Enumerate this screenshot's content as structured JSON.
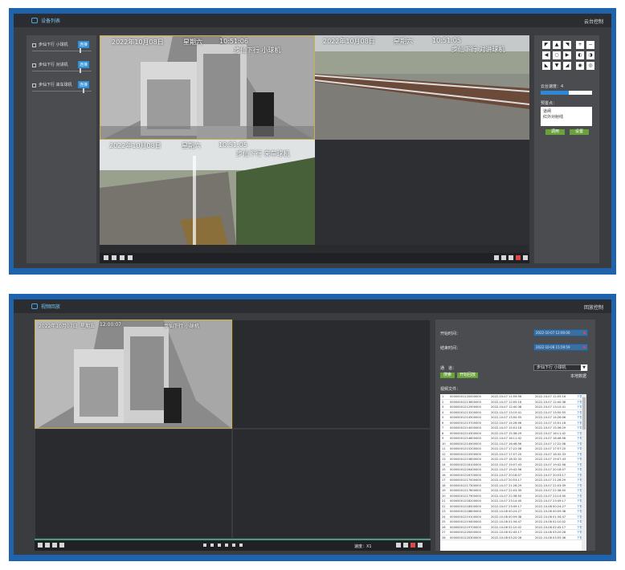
{
  "panel1": {
    "title": "设备列表",
    "right_label": "云台控制",
    "cameras": [
      {
        "name": "步仙下行 小球机",
        "state": "连接"
      },
      {
        "name": "步仙下行 对讲机",
        "state": "连接"
      },
      {
        "name": "步仙下行 来车球机",
        "state": "连接"
      }
    ],
    "videos": [
      {
        "date": "2022年10月08日",
        "weekday": "星期六",
        "time": "10:51:06",
        "camera": "步仙下行 小球机"
      },
      {
        "date": "2022年10月08日",
        "weekday": "星期六",
        "time": "10:51:05",
        "camera": "步仙下行 对讲球机"
      },
      {
        "date": "2022年10月08日",
        "weekday": "星期六",
        "time": "10:51:05",
        "camera": "步仙下行 来车球机"
      }
    ],
    "ptz": {
      "speed_label": "云台速度：",
      "speed_value": "4",
      "speed_fraction": 0.55,
      "preset_label": "预置点：",
      "presets": [
        "道闸",
        "红外对射线"
      ],
      "call_button": "调用",
      "set_button": "设置"
    }
  },
  "panel2": {
    "title": "视频回放",
    "right_label": "回放控制",
    "video": {
      "date": "2022年10月07日",
      "weekday": "星期五",
      "time": "12:00:07",
      "camera": "步仙下行 小球机"
    },
    "speed_label": "速度：X1",
    "form": {
      "start_label": "开始时间：",
      "start_value": "2022-10-07 12:00:00",
      "end_label": "结束时间：",
      "end_value": "2022-10-08 15:59:59",
      "channel_label": "通　道：",
      "channel_value": "步仙下行 小球机",
      "search_button": "搜索",
      "play_button": "开始回放",
      "local_label": "本地数据",
      "files_label": "视频文件："
    },
    "files": [
      {
        "no": "1",
        "file": "00000001120000000",
        "start": "2022-10-07 11:59:56",
        "end": "2022-10-07 12:05:16",
        "action": "下载"
      },
      {
        "no": "2",
        "file": "00000001213600000",
        "start": "2022-10-07 12:05:16",
        "end": "2022-10-07 12:40:38",
        "action": "下载"
      },
      {
        "no": "3",
        "file": "00000001212900000",
        "start": "2022-10-07 12:40:38",
        "end": "2022-10-07 13:15:41",
        "action": "下载"
      },
      {
        "no": "4",
        "file": "00000001213200000",
        "start": "2022-10-07 13:15:41",
        "end": "2022-10-07 13:50:55",
        "action": "下载"
      },
      {
        "no": "5",
        "file": "00000001214500000",
        "start": "2022-10-07 13:50:55",
        "end": "2022-10-07 14:26:06",
        "action": "下载"
      },
      {
        "no": "6",
        "file": "00000001213700000",
        "start": "2022-10-07 14:26:06",
        "end": "2022-10-07 15:01:18",
        "action": "下载"
      },
      {
        "no": "7",
        "file": "00000001214000000",
        "start": "2022-10-07 15:01:18",
        "end": "2022-10-07 15:36:29",
        "action": "下载"
      },
      {
        "no": "8",
        "file": "00000001214300000",
        "start": "2022-10-07 15:36:29",
        "end": "2022-10-07 16:11:42",
        "action": "下载"
      },
      {
        "no": "9",
        "file": "00000001214600000",
        "start": "2022-10-07 16:11:42",
        "end": "2022-10-07 16:46:56",
        "action": "下载"
      },
      {
        "no": "10",
        "file": "00000001214900000",
        "start": "2022-10-07 16:46:56",
        "end": "2022-10-07 17:22:08",
        "action": "下载"
      },
      {
        "no": "11",
        "file": "00000001215200000",
        "start": "2022-10-07 17:22:08",
        "end": "2022-10-07 17:57:20",
        "action": "下载"
      },
      {
        "no": "12",
        "file": "00000001215500000",
        "start": "2022-10-07 17:57:20",
        "end": "2022-10-07 18:32:33",
        "action": "下载"
      },
      {
        "no": "13",
        "file": "00000001215800000",
        "start": "2022-10-07 18:32:33",
        "end": "2022-10-07 19:07:43",
        "action": "下载"
      },
      {
        "no": "14",
        "file": "00000001216100000",
        "start": "2022-10-07 19:07:43",
        "end": "2022-10-07 19:42:56",
        "action": "下载"
      },
      {
        "no": "15",
        "file": "00000001216400000",
        "start": "2022-10-07 19:42:56",
        "end": "2022-10-07 20:18:07",
        "action": "下载"
      },
      {
        "no": "16",
        "file": "00000001216700000",
        "start": "2022-10-07 20:18:07",
        "end": "2022-10-07 20:53:17",
        "action": "下载"
      },
      {
        "no": "17",
        "file": "00000001217000000",
        "start": "2022-10-07 20:53:17",
        "end": "2022-10-07 21:28:29",
        "action": "下载"
      },
      {
        "no": "18",
        "file": "00000001217300000",
        "start": "2022-10-07 21:28:29",
        "end": "2022-10-07 22:03:39",
        "action": "下载"
      },
      {
        "no": "19",
        "file": "00000001217600000",
        "start": "2022-10-07 22:03:39",
        "end": "2022-10-07 22:38:50",
        "action": "下载"
      },
      {
        "no": "20",
        "file": "00000001217900000",
        "start": "2022-10-07 22:38:50",
        "end": "2022-10-07 23:14:00",
        "action": "下载"
      },
      {
        "no": "21",
        "file": "00000001218200000",
        "start": "2022-10-07 23:14:00",
        "end": "2022-10-07 23:49:17",
        "action": "下载"
      },
      {
        "no": "22",
        "file": "00000001218500000",
        "start": "2022-10-07 23:49:17",
        "end": "2022-10-08 00:24:27",
        "action": "下载"
      },
      {
        "no": "23",
        "file": "00000001218800000",
        "start": "2022-10-08 00:24:27",
        "end": "2022-10-08 00:59:38",
        "action": "下载"
      },
      {
        "no": "24",
        "file": "00000001219100000",
        "start": "2022-10-08 00:59:38",
        "end": "2022-10-08 01:34:47",
        "action": "下载"
      },
      {
        "no": "25",
        "file": "00000001219400000",
        "start": "2022-10-08 01:34:47",
        "end": "2022-10-08 02:10:02",
        "action": "下载"
      },
      {
        "no": "26",
        "file": "00000001219700000",
        "start": "2022-10-08 02:10:02",
        "end": "2022-10-08 02:45:17",
        "action": "下载"
      },
      {
        "no": "27",
        "file": "00000001220000000",
        "start": "2022-10-08 02:45:17",
        "end": "2022-10-08 03:20:28",
        "action": "下载"
      },
      {
        "no": "28",
        "file": "00000001220300000",
        "start": "2022-10-08 03:20:28",
        "end": "2022-10-08 03:55:36",
        "action": "下载"
      }
    ]
  }
}
